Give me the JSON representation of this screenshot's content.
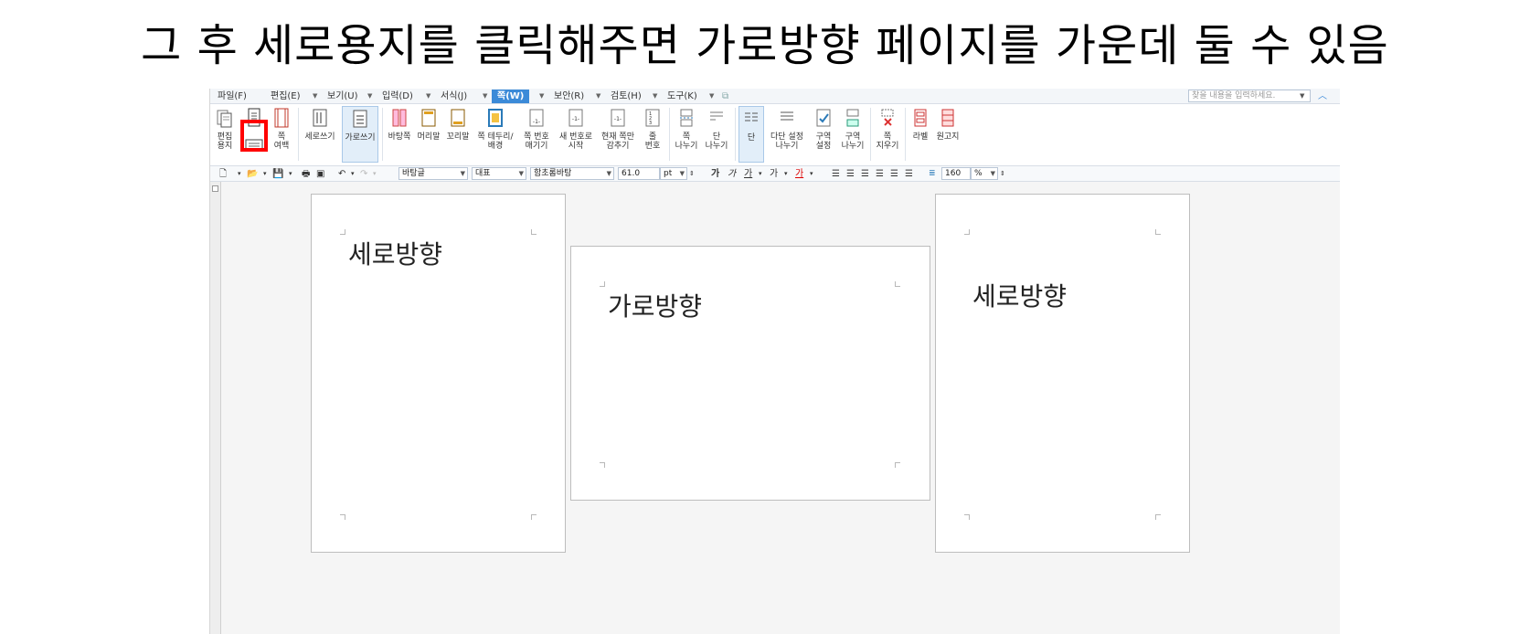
{
  "caption": "그 후 세로용지를 클릭해주면 가로방향 페이지를 가운데 둘 수 있음",
  "menu": {
    "items": [
      "파일(F)",
      "편집(E)",
      "보기(U)",
      "입력(D)",
      "서식(J)",
      "쪽(W)",
      "보안(R)",
      "검토(H)",
      "도구(K)"
    ],
    "active_index": 5,
    "search_placeholder": "찾을 내용을 입력하세요."
  },
  "ribbon": {
    "edit_paper": "편집\n용지",
    "page_margin": "쪽\n여백",
    "vertical_writing": "세로쓰기",
    "horizontal_writing": "가로쓰기",
    "background_page": "바탕쪽",
    "header": "머리말",
    "footer": "꼬리말",
    "border_bg": "쪽 테두리/\n배경",
    "page_number": "쪽 번호\n매기기",
    "new_number": "새 번호로\n시작",
    "hide_page": "현재 쪽만\n감추기",
    "line_number": "줄\n번호",
    "page_break": "쪽\n나누기",
    "col_break": "단\n나누기",
    "column": "단",
    "multi_col": "다단 설정\n나누기",
    "section_set": "구역\n설정",
    "section_break": "구역\n나누기",
    "page_delete": "쪽\n지우기",
    "label": "라벨",
    "manuscript": "원고지"
  },
  "toolbar": {
    "style": "바탕글",
    "lang": "대표",
    "font": "함초롬바탕",
    "size": "61.0",
    "unit": "pt",
    "bold": "가",
    "italic": "가",
    "underline": "가",
    "strike": "가",
    "color": "가",
    "line_spacing": "160",
    "percent": "%"
  },
  "pages": {
    "left": "세로방향",
    "middle": "가로방향",
    "right": "세로방향"
  },
  "colors": {
    "active_menu": "#3b8ad8",
    "highlight": "#ff0000"
  }
}
